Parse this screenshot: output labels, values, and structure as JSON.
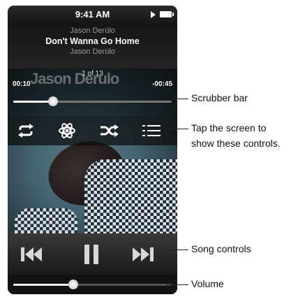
{
  "status": {
    "time": "9:41 AM"
  },
  "now_playing": {
    "artist_top": "Jason Derülo",
    "title": "Don't Wanna Go Home",
    "album": "Jason Derülo",
    "track_count": "1 of 13",
    "elapsed": "00:10",
    "remaining": "-00:45",
    "progress": 0.25,
    "artwork_text": "Jason Derulo"
  },
  "volume": {
    "level": 0.38
  },
  "controls": {
    "repeat": "repeat-icon",
    "genius": "genius-atom-icon",
    "shuffle": "shuffle-icon",
    "tracklist": "track-list-icon",
    "previous": "previous-track-icon",
    "pause": "pause-icon",
    "next": "next-track-icon"
  },
  "callouts": {
    "scrubber": "Scrubber bar",
    "tap_line1": "Tap the screen to",
    "tap_line2": "show these controls.",
    "song_controls": "Song controls",
    "volume": "Volume"
  }
}
